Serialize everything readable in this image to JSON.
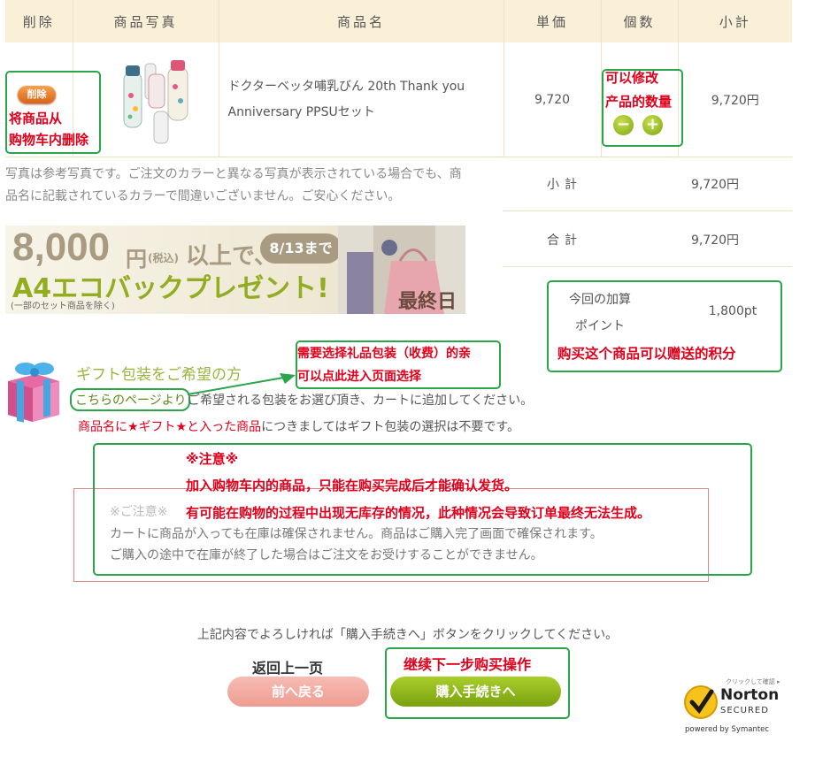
{
  "table": {
    "headers": [
      "削除",
      "商品写真",
      "商品名",
      "単価",
      "個数",
      "小計"
    ],
    "row": {
      "delete_label": "削除",
      "name_line1": "ドクターベッタ哺乳びん 20th Thank you",
      "name_line2": "Anniversary PPSUセット",
      "unit_price": "9,720",
      "subtotal": "9,720円"
    }
  },
  "annotations": {
    "delete": [
      "将商品从",
      "购物车内删除"
    ],
    "quantity": [
      "可以修改",
      "产品的数量"
    ],
    "gift": [
      "需要选择礼品包装（收费）的亲",
      "可以点此进入页面选择"
    ],
    "points": "购买这个商品可以赠送的积分",
    "notice": [
      "※注意※",
      "加入购物车内的商品，只能在购买完成后才能确认发货。",
      "有可能在购物的过程中出现无库存的情况，此种情况会导致订单最终无法生成。"
    ],
    "back": "返回上一页",
    "next": "继续下一步购买操作"
  },
  "photo_note": [
    "写真は参考写真です。ご注文のカラーと異なる写真が表示されている場合でも、商",
    "品名に記載されているカラーで間違いございません。ご安心ください。"
  ],
  "summary": {
    "subtotal_label": "小計",
    "subtotal_value": "9,720円",
    "total_label": "合計",
    "total_value": "9,720円",
    "points_label_1": "今回の加算",
    "points_label_2": "ポイント",
    "points_value": "1,800pt"
  },
  "banner": {
    "amount": "8,000",
    "yen": "円",
    "tax": "(税込)",
    "over": "以上で、",
    "date_badge": "8/13まで",
    "line2": "A4エコバックプレゼント!",
    "exclusion": "(一部のセット商品を除く)",
    "last_day": "最終日"
  },
  "gift": {
    "title": "ギフト包装をご希望の方",
    "link": "こちらのページより",
    "text1": "ご希望される包装をお選び頂き、カートに追加してください。",
    "red_part": "商品名に★ギフト★と入った商品",
    "text2": "につきましてはギフト包装の選択は不要です。"
  },
  "caution": {
    "title": "※ご注意※",
    "line1": "カートに商品が入っても在庫は確保されません。商品はご購入完了画面で確保されます。",
    "line2": "ご購入の途中で在庫が終了した場合はご注文をお受けすることができません。"
  },
  "confirm_text": "上記内容でよろしければ「購入手続きへ」ボタンをクリックしてください。",
  "buttons": {
    "back": "前へ戻る",
    "buy": "購入手続きへ"
  },
  "norton": {
    "top": "クリックして確認 ▸",
    "brand": "Norton",
    "secured": "SECURED",
    "powered": "powered by Symantec"
  },
  "colors": {
    "header_bg": "#faf0d7",
    "annotation_red": "#e0001b",
    "annotation_green": "#2aa54a",
    "buy_button": "#8db51a",
    "back_button": "#f2a89e"
  }
}
